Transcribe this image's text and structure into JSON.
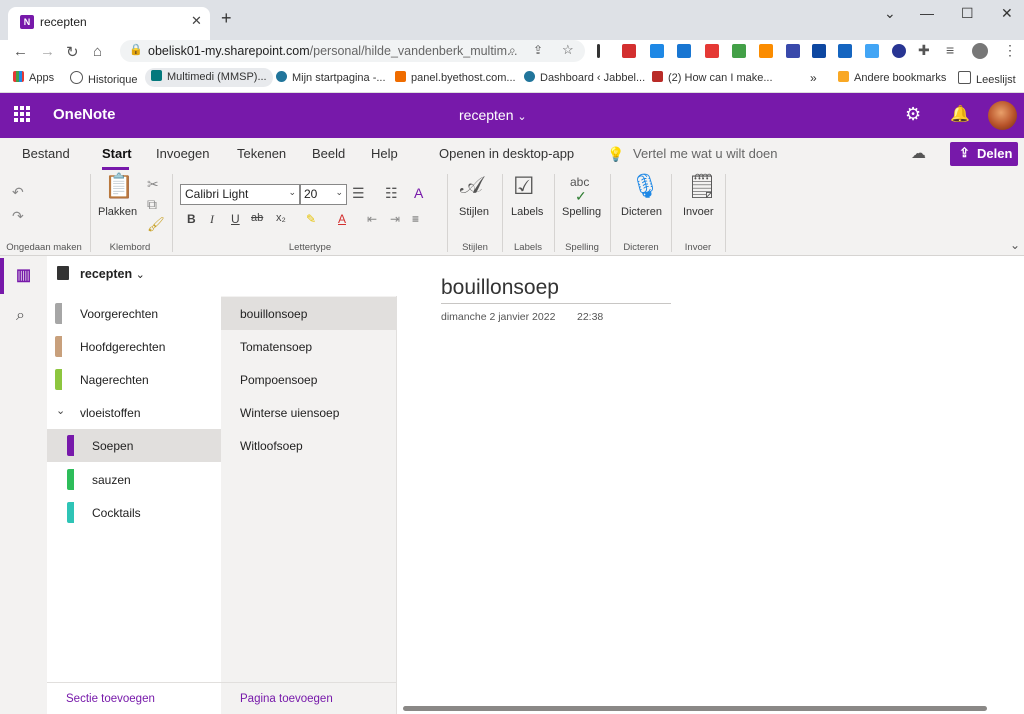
{
  "browser": {
    "tab_title": "recepten",
    "tab_favicon": "N",
    "url_host": "obelisk01-my.sharepoint.com",
    "url_path": "/personal/hilde_vandenberk_multim...",
    "bookmarks": [
      "Apps",
      "Historique",
      "Multimedi (MMSP)...",
      "Mijn startpagina -...",
      "panel.byethost.com...",
      "Dashboard ‹ Jabbel...",
      "(2) How can I make...",
      "Andere bookmarks",
      "Leeslijst"
    ],
    "overflow": "»"
  },
  "app": {
    "name": "OneNote",
    "notebook_title": "recepten",
    "accent": "#7719aa"
  },
  "ribbon": {
    "tabs": [
      "Bestand",
      "Start",
      "Invoegen",
      "Tekenen",
      "Beeld",
      "Help",
      "Openen in desktop-app"
    ],
    "tell_me": "Vertel me wat u wilt doen",
    "share": "Delen",
    "paste": "Plakken",
    "font_name": "Calibri Light",
    "font_size": "20",
    "styles": "Stijlen",
    "labels": "Labels",
    "spelling": "Spelling",
    "spelling_glyph": "abc",
    "dictate": "Dicteren",
    "insert": "Invoer",
    "groups": {
      "undo": "Ongedaan maken",
      "clipboard": "Klembord",
      "font": "Lettertype",
      "styles": "Stijlen",
      "labels": "Labels",
      "spelling": "Spelling",
      "dictate": "Dicteren",
      "insert": "Invoer"
    },
    "fmt": {
      "bold": "B",
      "italic": "I",
      "underline": "U",
      "strike": "ab",
      "sub": "x₂"
    }
  },
  "notebook": {
    "name": "recepten",
    "sections": [
      {
        "name": "Voorgerechten",
        "color": "#a6a6a6"
      },
      {
        "name": "Hoofdgerechten",
        "color": "#c8a07c"
      },
      {
        "name": "Nagerechten",
        "color": "#8dc63f"
      },
      {
        "name": "vloeistoffen",
        "color": ""
      },
      {
        "name": "Soepen",
        "color": "#7719aa"
      },
      {
        "name": "sauzen",
        "color": "#2dbd5a"
      },
      {
        "name": "Cocktails",
        "color": "#2ec4b6"
      }
    ],
    "pages": [
      "bouillonsoep",
      "Tomatensoep",
      "Pompoensoep",
      "Winterse uiensoep",
      "Witloofsoep"
    ],
    "add_section": "Sectie toevoegen",
    "add_page": "Pagina toevoegen"
  },
  "page": {
    "title": "bouillonsoep",
    "date": "dimanche 2 janvier 2022",
    "time": "22:38"
  }
}
